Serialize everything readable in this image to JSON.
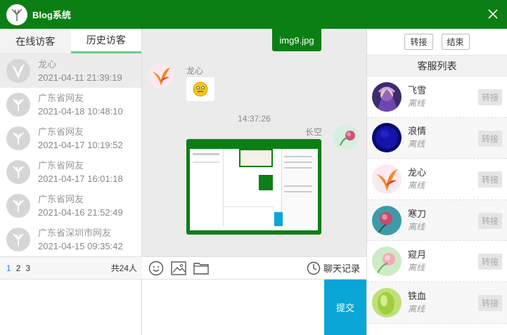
{
  "window": {
    "title": "Blog系统"
  },
  "tabs": [
    {
      "label": "在线访客"
    },
    {
      "label": "历史访客"
    }
  ],
  "visitors": [
    {
      "name": "龙心",
      "time": "2021-04-11 21:39:19"
    },
    {
      "name": "广东省网友",
      "time": "2021-04-18 10:48:10"
    },
    {
      "name": "广东省网友",
      "time": "2021-04-17 10:19:52"
    },
    {
      "name": "广东省网友",
      "time": "2021-04-17 16:01:18"
    },
    {
      "name": "广东省网友",
      "time": "2021-04-16 21:52:49"
    },
    {
      "name": "广东省深圳市网友",
      "time": "2021-04-15 09:35:42"
    }
  ],
  "pagination": {
    "pages": [
      "1",
      "2",
      "3"
    ],
    "total": "共24人"
  },
  "chat": {
    "file_tag": "img9.jpg",
    "incoming_name": "龙心",
    "time_separator": "14:37:26",
    "outgoing_name": "长空"
  },
  "toolbar": {
    "history_label": "聊天记录"
  },
  "submit_label": "提交",
  "right_actions": {
    "transfer": "转接",
    "end": "结束"
  },
  "agent_list_title": "客服列表",
  "agents": [
    {
      "name": "飞雪",
      "status": "离线",
      "action": "转接"
    },
    {
      "name": "浪情",
      "status": "离线",
      "action": "转接"
    },
    {
      "name": "龙心",
      "status": "离线",
      "action": "转接"
    },
    {
      "name": "寒刀",
      "status": "离线",
      "action": "转接"
    },
    {
      "name": "窥月",
      "status": "离线",
      "action": "转接"
    },
    {
      "name": "铁血",
      "status": "离线",
      "action": "转接"
    }
  ],
  "colors": {
    "brand_green": "#0b7f14",
    "submit_blue": "#0aa6d8",
    "tab_underline": "#6fcb8c"
  }
}
